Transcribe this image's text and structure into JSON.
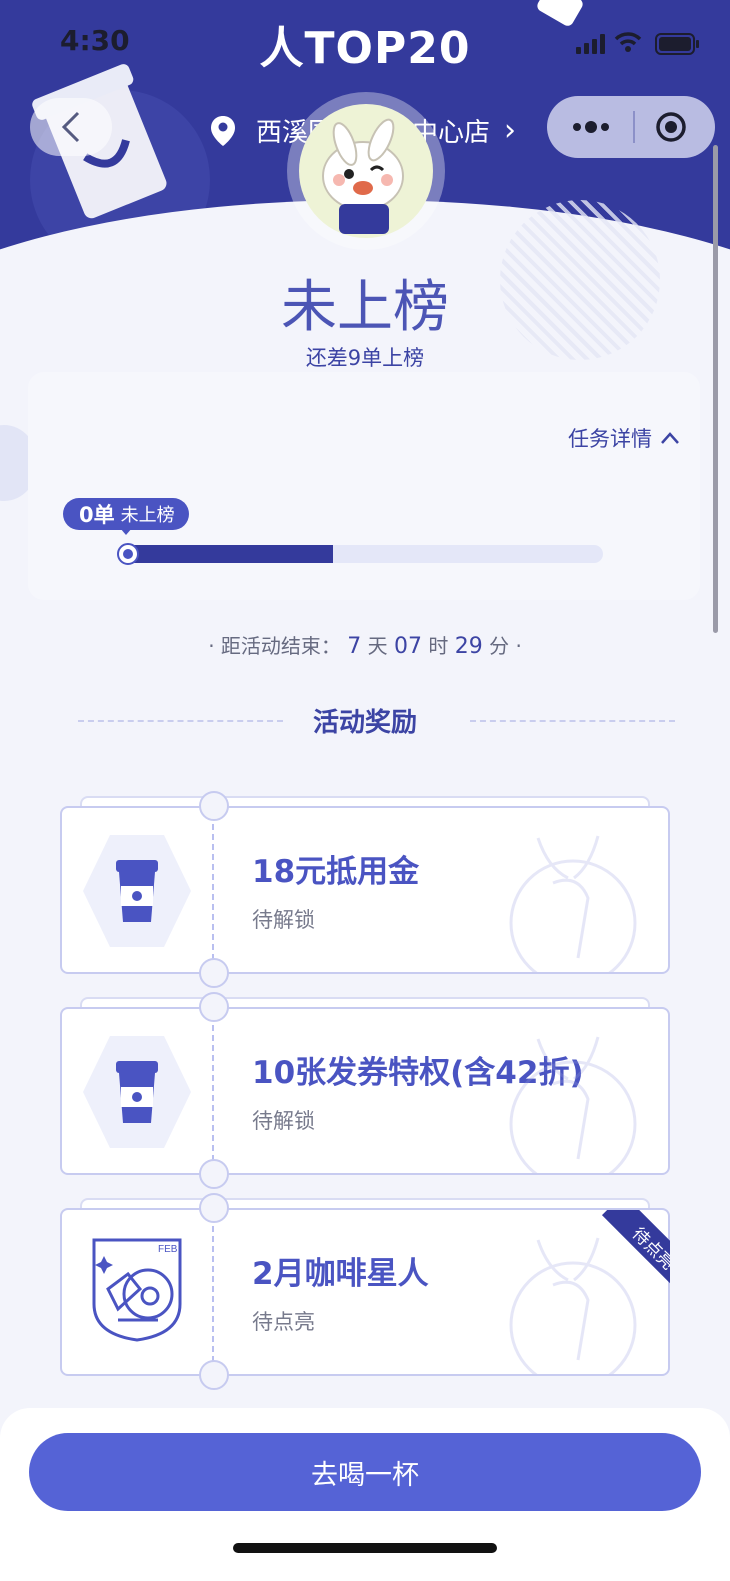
{
  "status_bar": {
    "time": "4:30"
  },
  "header": {
    "title": "人TOP20",
    "location": "西溪国际商务中心店",
    "location_arrow": "›"
  },
  "rank": {
    "status": "未上榜",
    "hint": "还差9单上榜"
  },
  "task": {
    "detail_label": "任务详情",
    "pill_count": "0单",
    "pill_status": "未上榜",
    "progress_fraction": 0.56
  },
  "countdown": {
    "prefix": "· 距活动结束：",
    "days": "7",
    "days_unit": "天",
    "hours": "07",
    "hours_unit": "时",
    "minutes": "29",
    "minutes_unit": "分",
    "suffix": "·"
  },
  "rewards": {
    "section_title": "活动奖励",
    "items": [
      {
        "title": "18元抵用金",
        "status": "待解锁",
        "icon": "coffee-cup-icon"
      },
      {
        "title": "10张发券特权(含42折)",
        "status": "待解锁",
        "icon": "coffee-cup-icon"
      },
      {
        "title": "2月咖啡星人",
        "status": "待点亮",
        "icon": "astronaut-badge-icon",
        "badge_month": "FEB",
        "ribbon": "待点亮"
      }
    ]
  },
  "cta": {
    "label": "去喝一杯"
  },
  "colors": {
    "primary": "#343a9c",
    "accent": "#4a54c2",
    "button": "#5563d6"
  }
}
